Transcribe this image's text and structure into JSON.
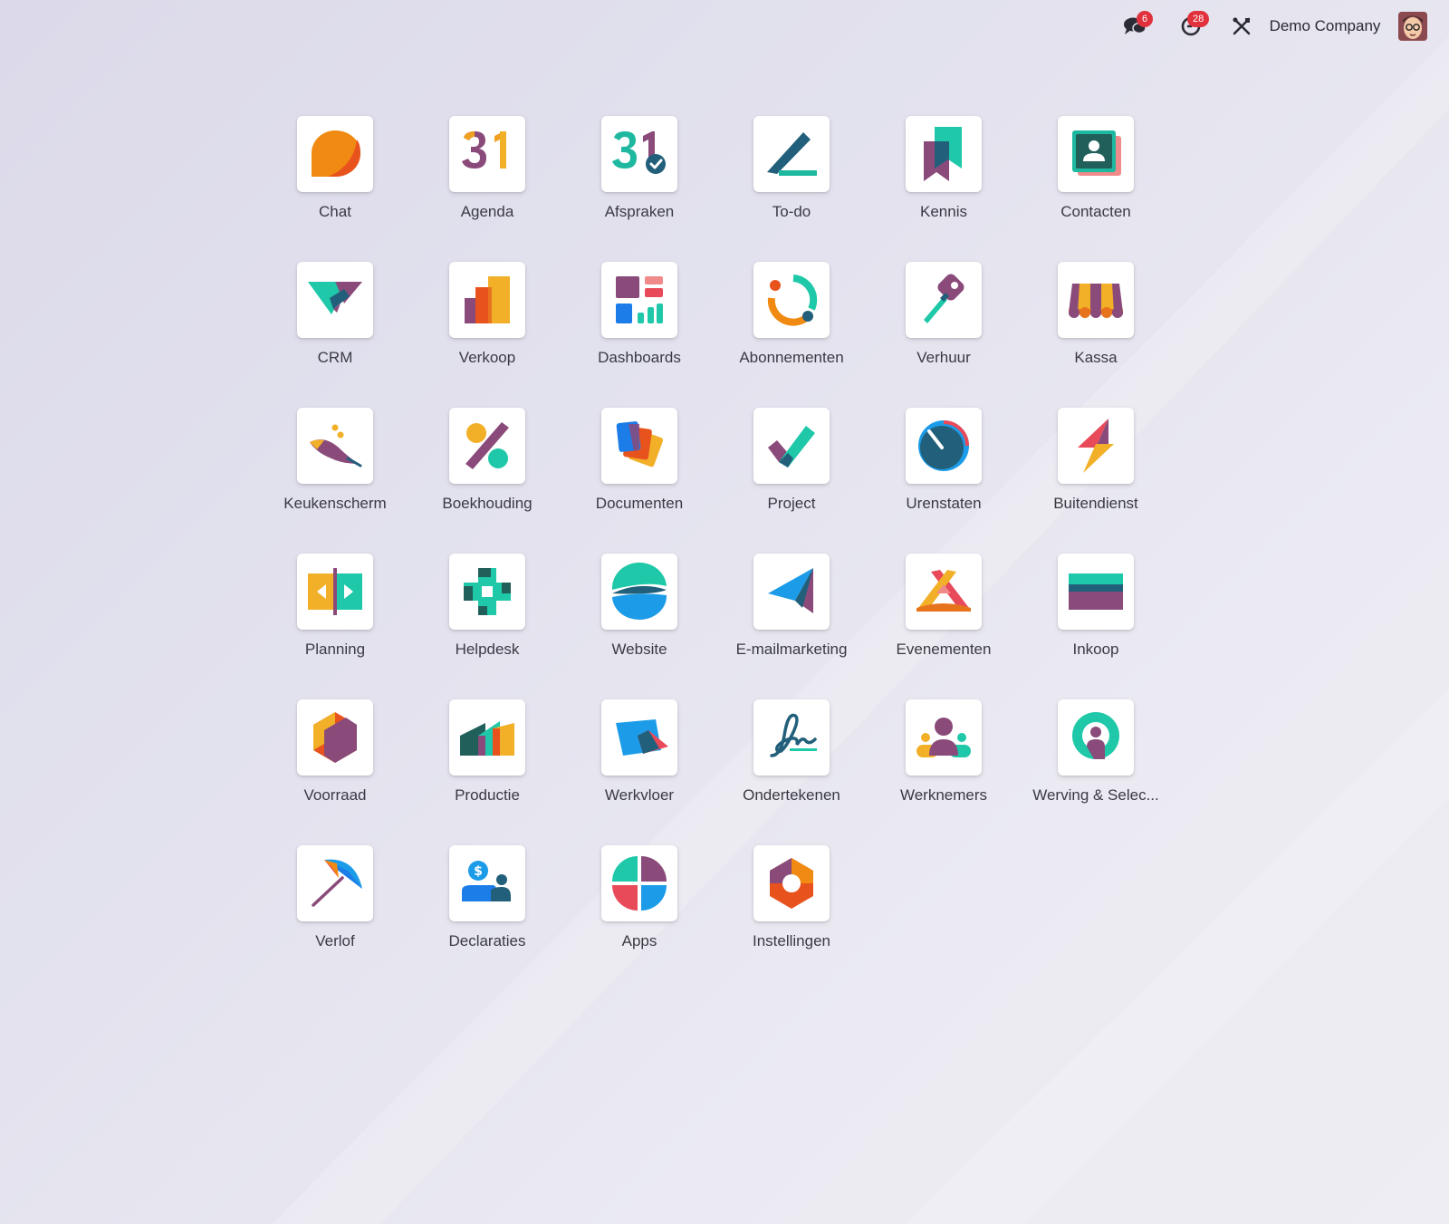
{
  "navbar": {
    "messages_badge": "6",
    "activities_badge": "28",
    "company_name": "Demo Company"
  },
  "apps": [
    {
      "label": "Chat",
      "icon": "chat-icon"
    },
    {
      "label": "Agenda",
      "icon": "calendar-icon"
    },
    {
      "label": "Afspraken",
      "icon": "appointments-icon"
    },
    {
      "label": "To-do",
      "icon": "todo-icon"
    },
    {
      "label": "Kennis",
      "icon": "knowledge-icon"
    },
    {
      "label": "Contacten",
      "icon": "contacts-icon"
    },
    {
      "label": "CRM",
      "icon": "crm-icon"
    },
    {
      "label": "Verkoop",
      "icon": "sales-icon"
    },
    {
      "label": "Dashboards",
      "icon": "dashboards-icon"
    },
    {
      "label": "Abonnementen",
      "icon": "subscriptions-icon"
    },
    {
      "label": "Verhuur",
      "icon": "rental-icon"
    },
    {
      "label": "Kassa",
      "icon": "pos-icon"
    },
    {
      "label": "Keukenscherm",
      "icon": "kitchen-display-icon"
    },
    {
      "label": "Boekhouding",
      "icon": "accounting-icon"
    },
    {
      "label": "Documenten",
      "icon": "documents-icon"
    },
    {
      "label": "Project",
      "icon": "project-icon"
    },
    {
      "label": "Urenstaten",
      "icon": "timesheets-icon"
    },
    {
      "label": "Buitendienst",
      "icon": "field-service-icon"
    },
    {
      "label": "Planning",
      "icon": "planning-icon"
    },
    {
      "label": "Helpdesk",
      "icon": "helpdesk-icon"
    },
    {
      "label": "Website",
      "icon": "website-icon"
    },
    {
      "label": "E-mailmarketing",
      "icon": "email-marketing-icon"
    },
    {
      "label": "Evenementen",
      "icon": "events-icon"
    },
    {
      "label": "Inkoop",
      "icon": "purchase-icon"
    },
    {
      "label": "Voorraad",
      "icon": "inventory-icon"
    },
    {
      "label": "Productie",
      "icon": "manufacturing-icon"
    },
    {
      "label": "Werkvloer",
      "icon": "shop-floor-icon"
    },
    {
      "label": "Ondertekenen",
      "icon": "sign-icon"
    },
    {
      "label": "Werknemers",
      "icon": "employees-icon"
    },
    {
      "label": "Werving & Selec...",
      "icon": "recruitment-icon"
    },
    {
      "label": "Verlof",
      "icon": "time-off-icon"
    },
    {
      "label": "Declaraties",
      "icon": "expenses-icon"
    },
    {
      "label": "Apps",
      "icon": "apps-icon"
    },
    {
      "label": "Instellingen",
      "icon": "settings-icon"
    }
  ]
}
